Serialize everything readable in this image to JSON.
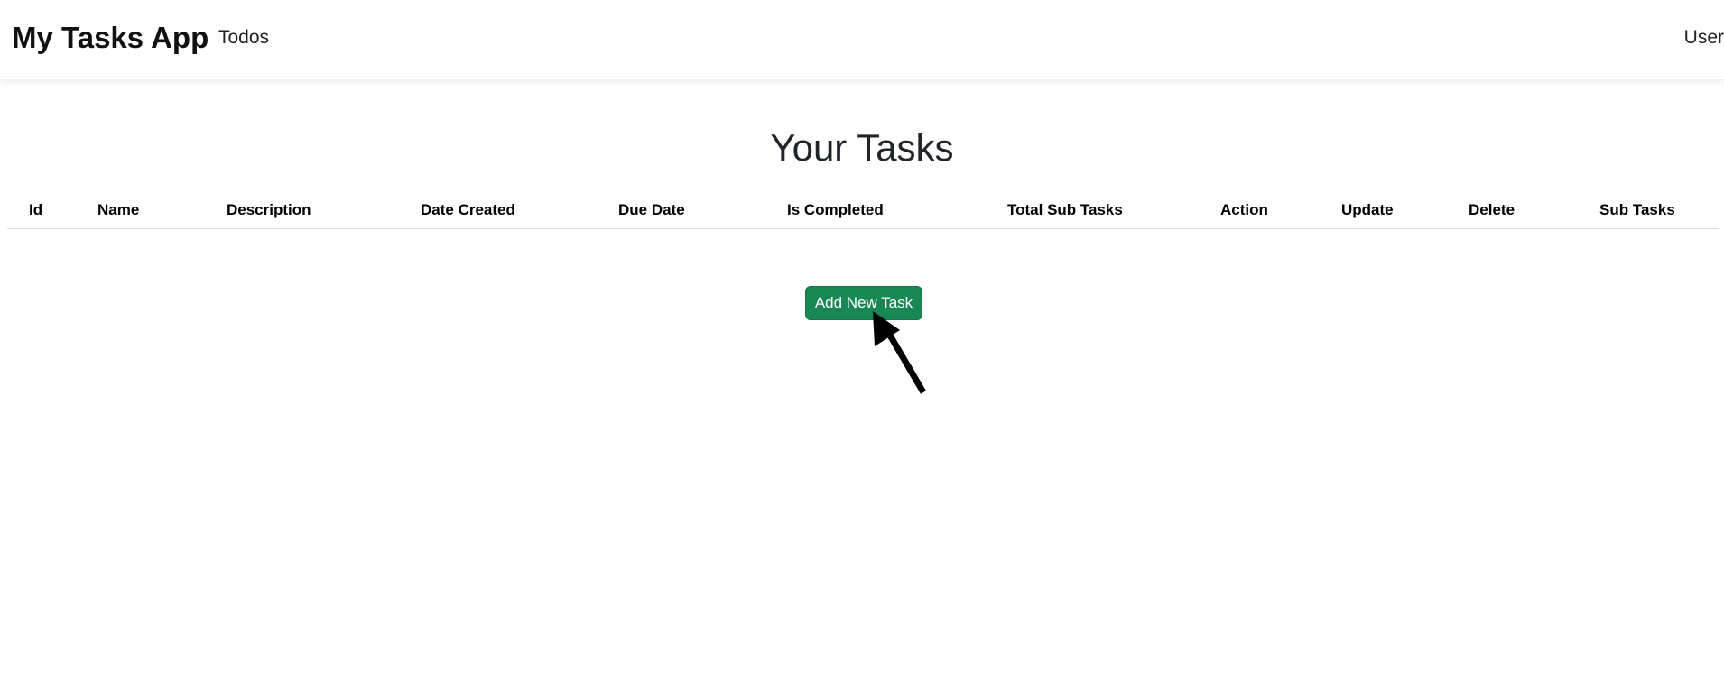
{
  "navbar": {
    "brand": "My Tasks App",
    "link_todos": "Todos",
    "link_user": "User"
  },
  "main": {
    "title": "Your Tasks",
    "table": {
      "columns": [
        "Id",
        "Name",
        "Description",
        "Date Created",
        "Due Date",
        "Is Completed",
        "Total Sub Tasks",
        "Action",
        "Update",
        "Delete",
        "Sub Tasks"
      ],
      "rows": []
    },
    "add_button_label": "Add New Task"
  },
  "colors": {
    "button_bg": "#198754",
    "button_text": "#ffffff"
  },
  "icons": {
    "pointer": "arrow-pointer-icon"
  }
}
